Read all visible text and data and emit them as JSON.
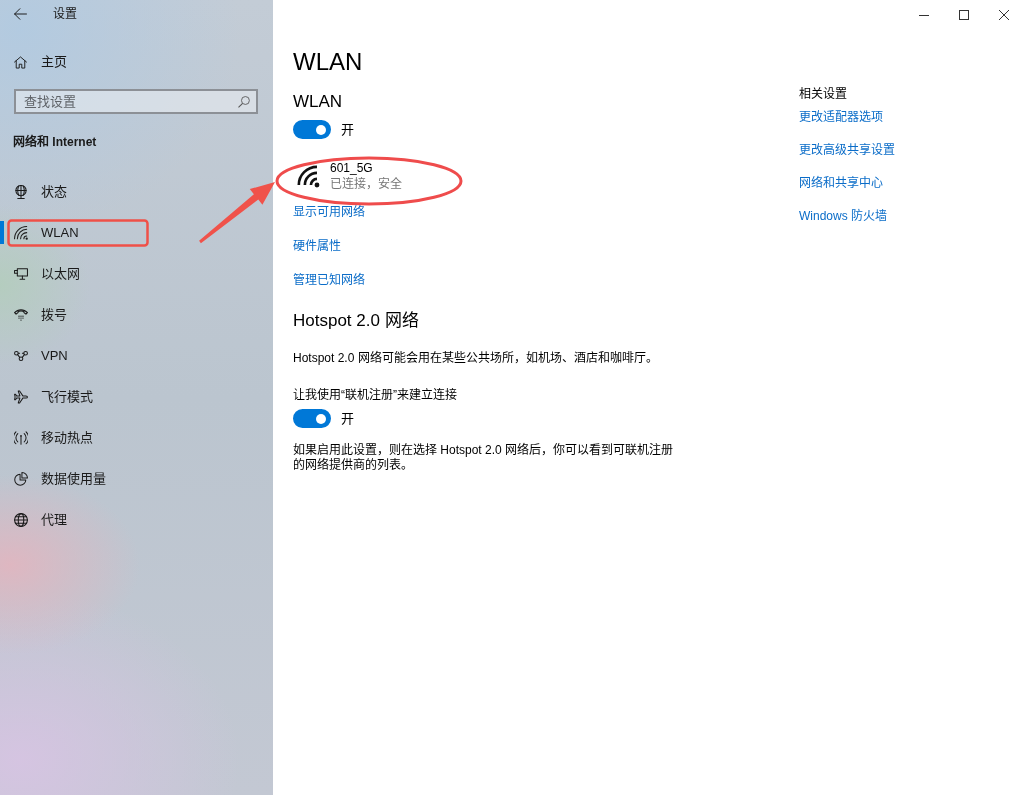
{
  "window": {
    "title": "设置"
  },
  "sidebar": {
    "home": "主页",
    "search": {
      "placeholder": "查找设置"
    },
    "section_title": "网络和 Internet",
    "items": [
      {
        "label": "状态",
        "selected": false
      },
      {
        "label": "WLAN",
        "selected": true
      },
      {
        "label": "以太网",
        "selected": false
      },
      {
        "label": "拨号",
        "selected": false
      },
      {
        "label": "VPN",
        "selected": false
      },
      {
        "label": "飞行模式",
        "selected": false
      },
      {
        "label": "移动热点",
        "selected": false
      },
      {
        "label": "数据使用量",
        "selected": false
      },
      {
        "label": "代理",
        "selected": false
      }
    ]
  },
  "main": {
    "title": "WLAN",
    "wlan": {
      "heading": "WLAN",
      "toggle": {
        "on": true,
        "label": "开"
      },
      "network": {
        "name": "601_5G",
        "status": "已连接，安全"
      },
      "links": [
        "显示可用网络",
        "硬件属性",
        "管理已知网络"
      ]
    },
    "hotspot": {
      "heading": "Hotspot 2.0 网络",
      "description": "Hotspot 2.0 网络可能会用在某些公共场所，如机场、酒店和咖啡厅。",
      "setting_label": "让我使用“联机注册”来建立连接",
      "toggle": {
        "on": true,
        "label": "开"
      },
      "note": "如果启用此设置，则在选择 Hotspot 2.0 网络后，你可以看到可联机注册的网络提供商的列表。"
    }
  },
  "related_settings": {
    "heading": "相关设置",
    "links": [
      "更改适配器选项",
      "更改高级共享设置",
      "网络和共享中心",
      "Windows 防火墙"
    ]
  }
}
